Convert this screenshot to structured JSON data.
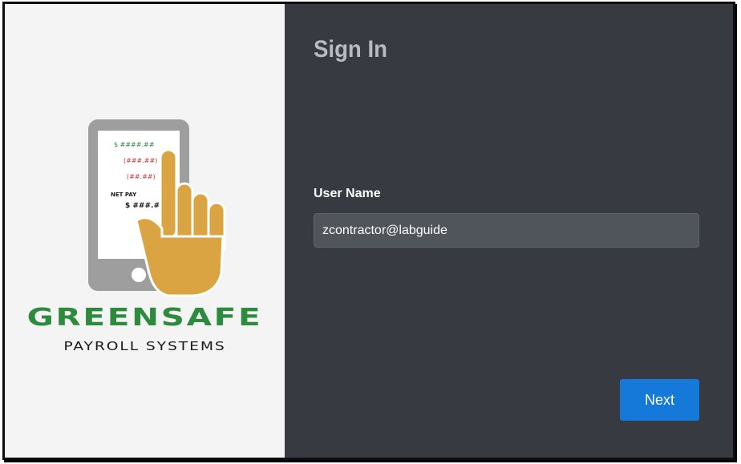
{
  "logo": {
    "phone_lines": [
      "$ ####.##",
      "(###.##)",
      "(##.##)",
      "NET PAY",
      "$ ###.##"
    ],
    "brand_name": "GREENSAFE",
    "brand_tagline": "PAYROLL SYSTEMS",
    "colors": {
      "green": "#2e8b3d",
      "red": "#e0302f",
      "hand": "#d9a441",
      "phone": "#9e9e9e"
    }
  },
  "signin": {
    "title": "Sign In",
    "username_label": "User Name",
    "username_value": "zcontractor@labguide",
    "next_label": "Next"
  },
  "colors": {
    "panel_bg": "#373a40",
    "button": "#1479d8"
  }
}
